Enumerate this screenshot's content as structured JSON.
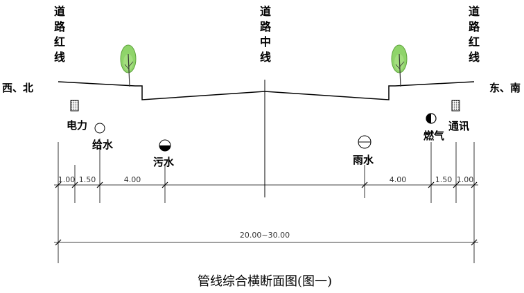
{
  "labels": {
    "left_red_line": "道路红线",
    "center_line": "道路中线",
    "right_red_line": "道路红线",
    "west_north": "西、北",
    "east_south": "东、南"
  },
  "pipes": {
    "power": "电力",
    "water_supply": "给水",
    "sewage": "污水",
    "rain": "雨水",
    "gas": "燃气",
    "telecom": "通讯"
  },
  "dimensions": {
    "left": [
      "1.00",
      "1.50",
      "4.00"
    ],
    "right": [
      "4.00",
      "1.50",
      "1.00"
    ],
    "total": "20.00~30.00"
  },
  "caption": "管线综合横断面图(图一)",
  "colors": {
    "tree": "#8fd46a",
    "line": "#000000"
  }
}
